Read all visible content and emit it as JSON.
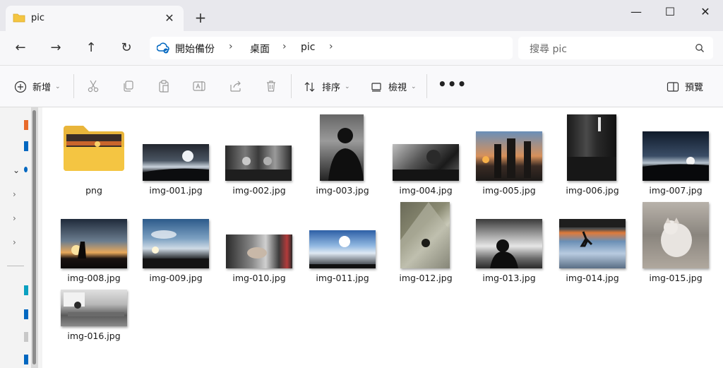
{
  "window": {
    "tab_title": "pic",
    "tab_close": "✕",
    "new_tab": "+",
    "minimize": "—",
    "maximize": "☐",
    "close": "✕"
  },
  "nav": {
    "back": "←",
    "forward": "→",
    "up": "↑",
    "refresh": "↻",
    "breadcrumbs": [
      "開始備份",
      "桌面",
      "pic"
    ],
    "separator": "›",
    "search_placeholder": "搜尋 pic"
  },
  "toolbar": {
    "new_label": "新增",
    "sort_label": "排序",
    "view_label": "檢視",
    "more_label": "•••",
    "preview_label": "預覽",
    "chevron": "⌄"
  },
  "files": [
    {
      "name": "png",
      "kind": "folder"
    },
    {
      "name": "img-001.jpg",
      "kind": "image"
    },
    {
      "name": "img-002.jpg",
      "kind": "image"
    },
    {
      "name": "img-003.jpg",
      "kind": "image"
    },
    {
      "name": "img-004.jpg",
      "kind": "image"
    },
    {
      "name": "img-005.jpg",
      "kind": "image"
    },
    {
      "name": "img-006.jpg",
      "kind": "image"
    },
    {
      "name": "img-007.jpg",
      "kind": "image"
    },
    {
      "name": "img-008.jpg",
      "kind": "image"
    },
    {
      "name": "img-009.jpg",
      "kind": "image"
    },
    {
      "name": "img-010.jpg",
      "kind": "image"
    },
    {
      "name": "img-011.jpg",
      "kind": "image"
    },
    {
      "name": "img-012.jpg",
      "kind": "image"
    },
    {
      "name": "img-013.jpg",
      "kind": "image"
    },
    {
      "name": "img-014.jpg",
      "kind": "image"
    },
    {
      "name": "img-015.jpg",
      "kind": "image"
    },
    {
      "name": "img-016.jpg",
      "kind": "image"
    }
  ],
  "colors": {
    "folder_yellow": "#f4c542",
    "accent_blue": "#0067c0"
  }
}
